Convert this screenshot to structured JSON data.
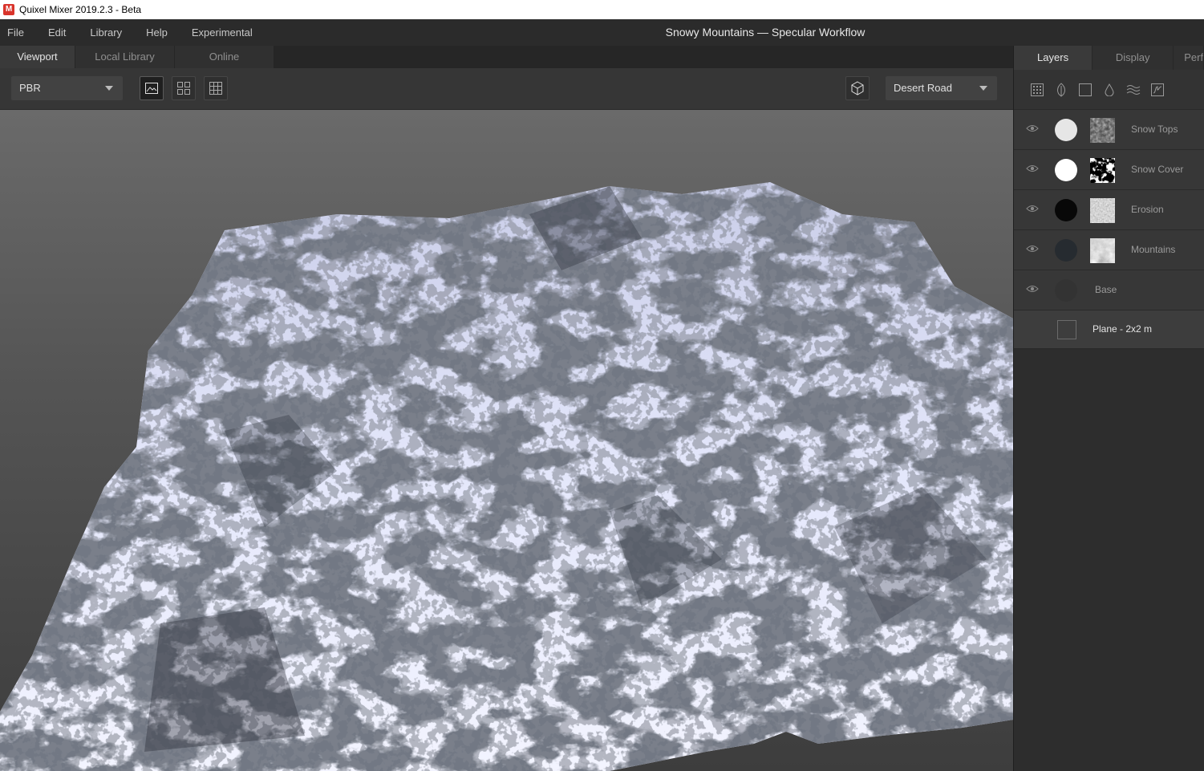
{
  "window": {
    "title": "Quixel Mixer 2019.2.3 - Beta"
  },
  "menu": [
    "File",
    "Edit",
    "Library",
    "Help",
    "Experimental"
  ],
  "document_title": "Snowy Mountains — Specular Workflow",
  "viewport_tabs": [
    {
      "label": "Viewport",
      "active": true
    },
    {
      "label": "Local Library",
      "active": false
    },
    {
      "label": "Online",
      "active": false
    }
  ],
  "toolbar": {
    "render_mode": "PBR",
    "view_buttons": [
      "single-view-icon",
      "quad-view-icon",
      "grid-view-icon"
    ],
    "environment_button": "cube-icon",
    "environment": "Desert Road"
  },
  "panel_tabs": [
    {
      "label": "Layers",
      "active": true
    },
    {
      "label": "Display",
      "active": false
    },
    {
      "label": "Perf",
      "active": false
    }
  ],
  "layer_tools": [
    "texture-grid-icon",
    "leaf-icon",
    "square-icon",
    "drop-icon",
    "waves-icon",
    "curve-icon"
  ],
  "layers": [
    {
      "name": "Snow Tops",
      "color": "#e6e6e6",
      "mask": "noise"
    },
    {
      "name": "Snow Cover",
      "color": "#ffffff",
      "mask": "blotch"
    },
    {
      "name": "Erosion",
      "color": "#080808",
      "mask": "grain"
    },
    {
      "name": "Mountains",
      "color": "#262b30",
      "mask": "cloud"
    },
    {
      "name": "Base",
      "color": "#333333",
      "mask": ""
    }
  ],
  "mesh": {
    "name": "Plane - 2x2 m"
  },
  "colors": {
    "accent_red": "#d9342b",
    "snow": "#e8ecff",
    "rock": "#2c3037"
  }
}
